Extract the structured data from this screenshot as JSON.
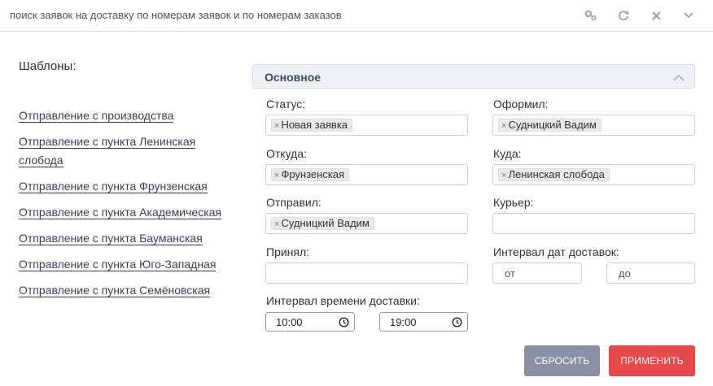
{
  "header": {
    "title": "поиск заявок на доставку по номерам заявок и по номерам заказов",
    "icons": [
      "settings-icon",
      "refresh-icon",
      "close-icon",
      "chevron-down-icon"
    ]
  },
  "templates": {
    "title": "Шаблоны:",
    "items": [
      "Отправление с производства",
      "Отправление с пункта Ленинская слобода",
      "Отправление с пункта Фрунзенская",
      "Отправление с пункта Академическая",
      "Отправление с пункта Бауманская",
      "Отправление с пункта Юго-Западная",
      "Отправление с пункта Семёновская"
    ]
  },
  "section": {
    "title": "Основное"
  },
  "fields": {
    "status": {
      "label": "Статус:",
      "tag": "Новая заявка"
    },
    "created_by": {
      "label": "Оформил:",
      "tag": "Судницкий Вадим"
    },
    "from": {
      "label": "Откуда:",
      "tag": "Фрунзенская"
    },
    "to": {
      "label": "Куда:",
      "tag": "Ленинская слобода"
    },
    "sent_by": {
      "label": "Отправил:",
      "tag": "Судницкий Вадим"
    },
    "courier": {
      "label": "Курьер:",
      "value": ""
    },
    "received_by": {
      "label": "Принял:",
      "value": ""
    },
    "date_interval": {
      "label": "Интервал дат доставок:",
      "from_placeholder": "от",
      "to_placeholder": "до"
    },
    "time_interval": {
      "label": "Интервал времени доставки:",
      "from": "10:00",
      "to": "19:00"
    }
  },
  "buttons": {
    "reset": "СБРОСИТЬ",
    "apply": "ПРИМЕНИТЬ"
  },
  "colors": {
    "apply": "#e64a4a",
    "reset": "#8a8fa5",
    "link": "#3a3f5c",
    "section_bg": "#eef1f5"
  }
}
